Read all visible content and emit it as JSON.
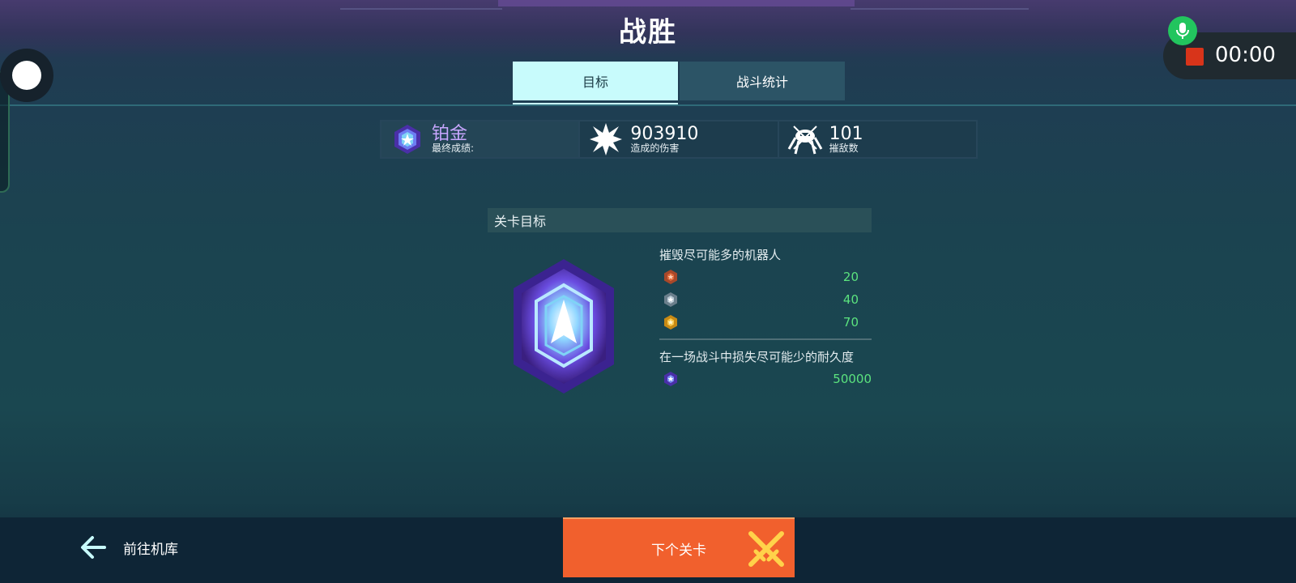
{
  "header": {
    "title": "战胜"
  },
  "tabs": [
    {
      "label": "目标",
      "active": true
    },
    {
      "label": "战斗统计",
      "active": false
    }
  ],
  "stats": {
    "rank": {
      "value": "铂金",
      "label": "最终成绩:",
      "icon": "platinum-rank-icon"
    },
    "damage": {
      "value": "903910",
      "label": "造成的伤害",
      "icon": "explosion-icon"
    },
    "kills": {
      "value": "101",
      "label": "摧敌数",
      "icon": "destroyed-robot-icon"
    }
  },
  "objectives": {
    "header": "关卡目标",
    "destroy": {
      "title": "摧毁尽可能多的机器人",
      "tiers": [
        {
          "icon": "bronze-rank-icon",
          "value": "20"
        },
        {
          "icon": "silver-rank-icon",
          "value": "40"
        },
        {
          "icon": "gold-rank-icon",
          "value": "70"
        }
      ]
    },
    "durability": {
      "title": "在一场战斗中损失尽可能少的耐久度",
      "tiers": [
        {
          "icon": "platinum-rank-icon",
          "value": "50000"
        }
      ]
    }
  },
  "footer": {
    "back_label": "前往机库",
    "next_label": "下个关卡"
  },
  "recorder": {
    "time": "00:00"
  },
  "colors": {
    "accent_tab": "#c8fbfc",
    "next_button": "#f1602d",
    "value_green": "#5be37e",
    "rank_purple": "#c9a7ff"
  }
}
